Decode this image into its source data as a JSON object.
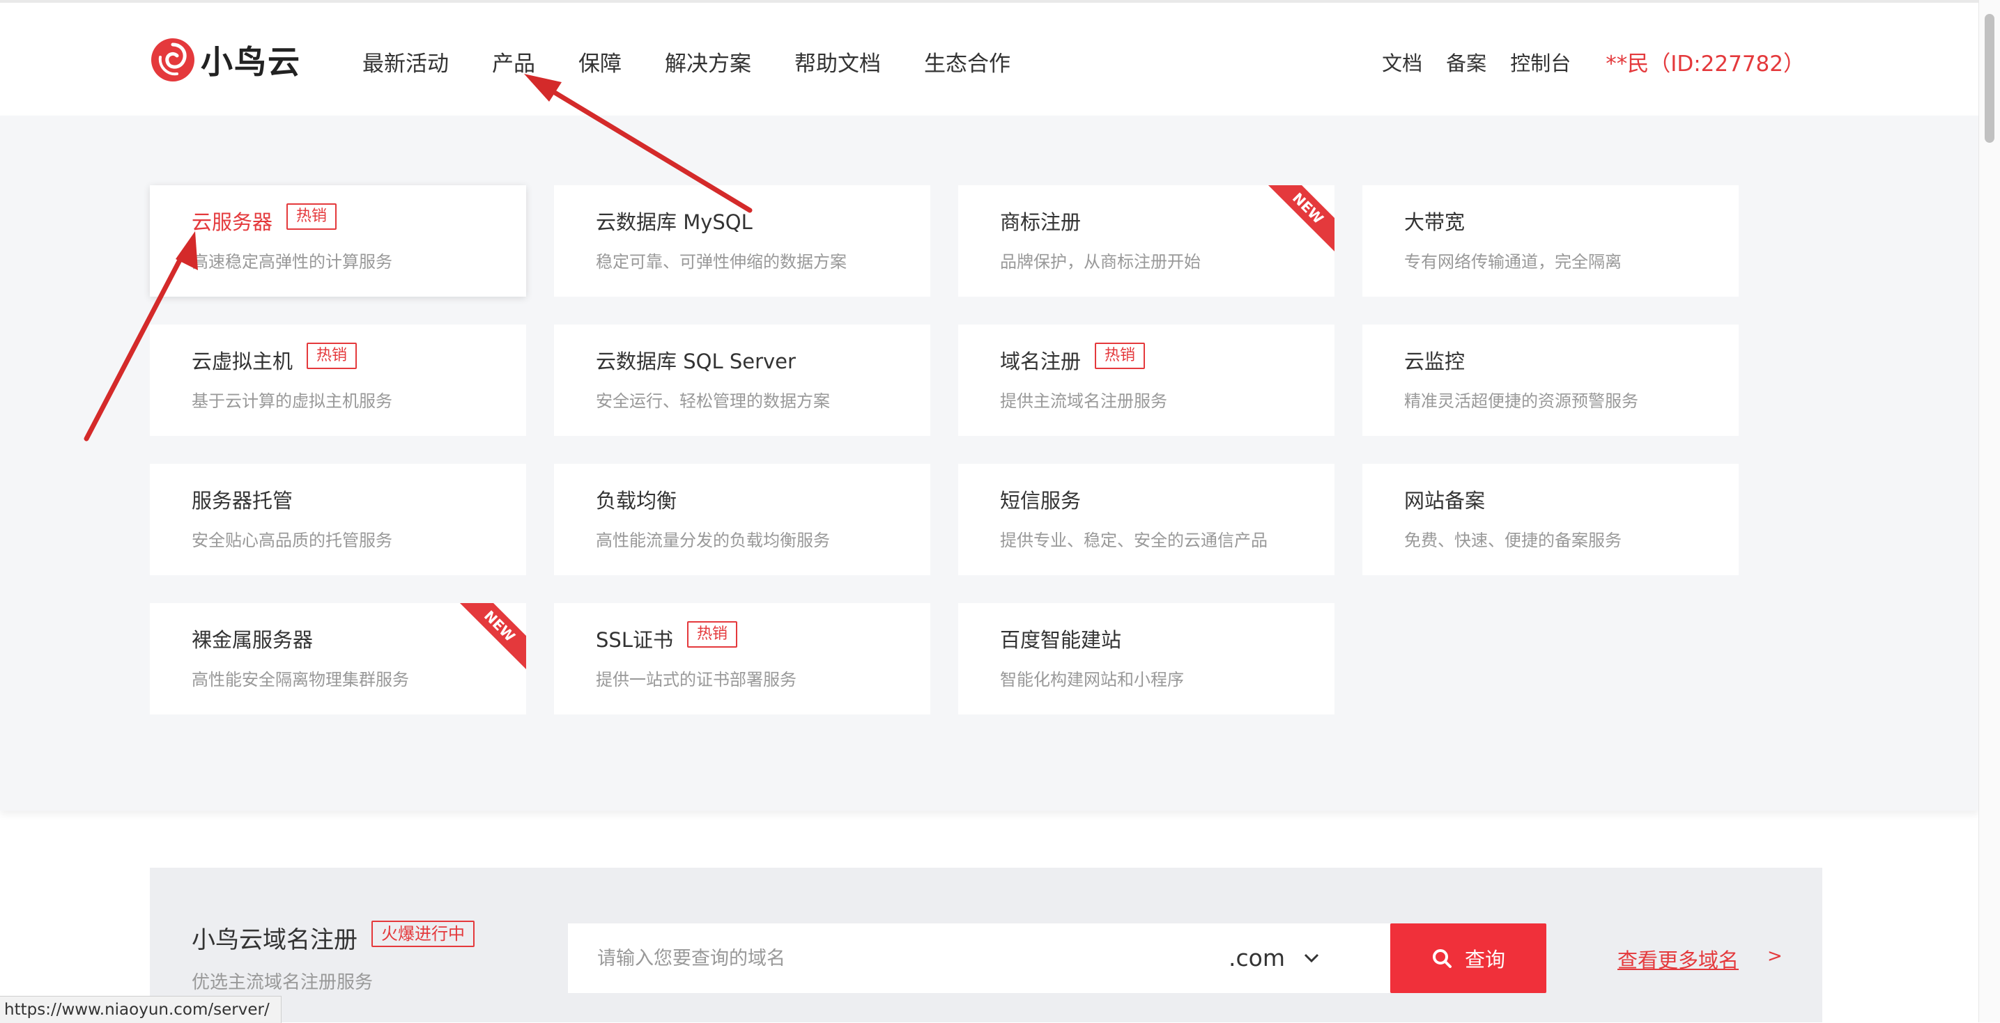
{
  "header": {
    "logo_text": "小鸟云",
    "nav": [
      "最新活动",
      "产品",
      "保障",
      "解决方案",
      "帮助文档",
      "生态合作"
    ],
    "right_links": [
      "文档",
      "备案",
      "控制台"
    ],
    "user": "**民（ID:227782）"
  },
  "products": [
    {
      "title": "云服务器",
      "desc": "高速稳定高弹性的计算服务",
      "tag": "热销",
      "ribbon": ""
    },
    {
      "title": "云数据库 MySQL",
      "desc": "稳定可靠、可弹性伸缩的数据方案",
      "tag": "",
      "ribbon": ""
    },
    {
      "title": "商标注册",
      "desc": "品牌保护，从商标注册开始",
      "tag": "",
      "ribbon": "NEW"
    },
    {
      "title": "大带宽",
      "desc": "专有网络传输通道，完全隔离",
      "tag": "",
      "ribbon": ""
    },
    {
      "title": "云虚拟主机",
      "desc": "基于云计算的虚拟主机服务",
      "tag": "热销",
      "ribbon": ""
    },
    {
      "title": "云数据库 SQL Server",
      "desc": "安全运行、轻松管理的数据方案",
      "tag": "",
      "ribbon": ""
    },
    {
      "title": "域名注册",
      "desc": "提供主流域名注册服务",
      "tag": "热销",
      "ribbon": ""
    },
    {
      "title": "云监控",
      "desc": "精准灵活超便捷的资源预警服务",
      "tag": "",
      "ribbon": ""
    },
    {
      "title": "服务器托管",
      "desc": "安全贴心高品质的托管服务",
      "tag": "",
      "ribbon": ""
    },
    {
      "title": "负载均衡",
      "desc": "高性能流量分发的负载均衡服务",
      "tag": "",
      "ribbon": ""
    },
    {
      "title": "短信服务",
      "desc": "提供专业、稳定、安全的云通信产品",
      "tag": "",
      "ribbon": ""
    },
    {
      "title": "网站备案",
      "desc": "免费、快速、便捷的备案服务",
      "tag": "",
      "ribbon": ""
    },
    {
      "title": "裸金属服务器",
      "desc": "高性能安全隔离物理集群服务",
      "tag": "",
      "ribbon": "NEW"
    },
    {
      "title": "SSL证书",
      "desc": "提供一站式的证书部署服务",
      "tag": "热销",
      "ribbon": ""
    },
    {
      "title": "百度智能建站",
      "desc": "智能化构建网站和小程序",
      "tag": "",
      "ribbon": ""
    }
  ],
  "domain": {
    "title": "小鸟云域名注册",
    "tag": "火爆进行中",
    "subtitle": "优选主流域名注册服务",
    "placeholder": "请输入您要查询的域名",
    "suffix": ".com",
    "search_label": "查询",
    "more_link": "查看更多域名",
    "more_arrow": ">"
  },
  "status_url": "https://www.niaoyun.com/server/",
  "colors": {
    "accent": "#e4393c",
    "panel_bg": "#f5f6f8",
    "button": "#f0303a",
    "annotation_arrow": "#d42a2a"
  },
  "icons": [
    "logo-swirl-icon",
    "chevron-down-icon",
    "search-icon",
    "annotation-arrow-icon"
  ]
}
